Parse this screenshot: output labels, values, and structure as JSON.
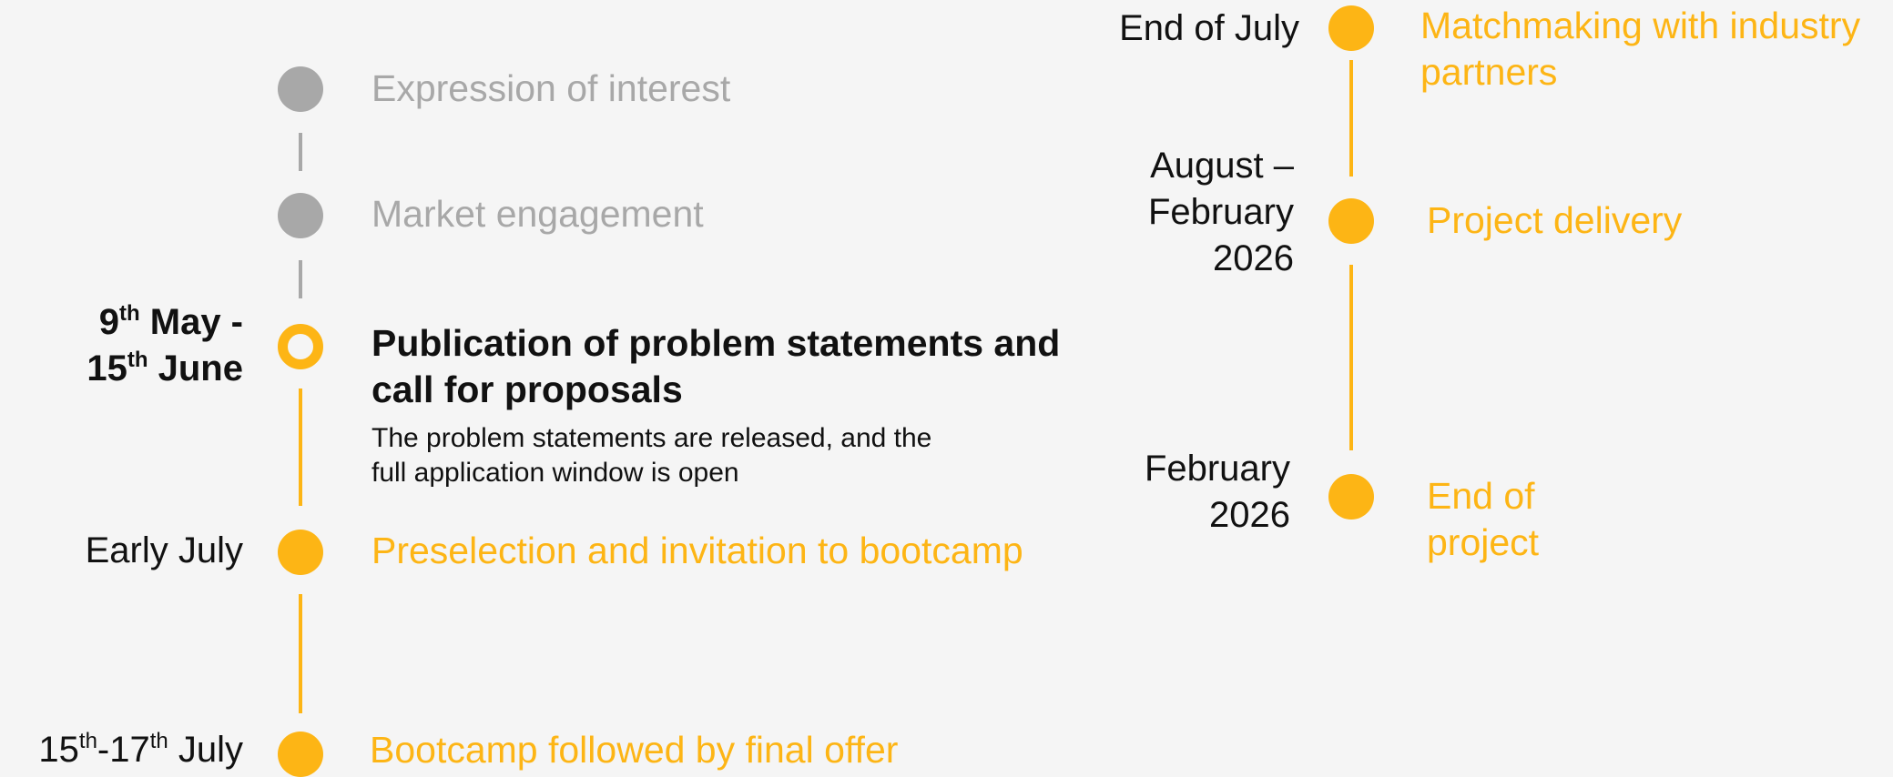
{
  "colors": {
    "accent": "#fdb515",
    "muted": "#a8a8a8",
    "text": "#111111",
    "background": "#f5f5f5"
  },
  "left": {
    "expression": {
      "label": "Expression of interest"
    },
    "market": {
      "label": "Market engagement"
    },
    "publication": {
      "date_1_num": "9",
      "date_1_sup": "th",
      "date_1_rest": " May -",
      "date_2_num": "15",
      "date_2_sup": "th",
      "date_2_rest": " June",
      "label_line1": "Publication of problem statements and",
      "label_line2": "call for proposals",
      "desc_line1": "The problem statements are released, and the",
      "desc_line2": "full application window is open"
    },
    "preselection": {
      "date": "Early July",
      "label": "Preselection and invitation to bootcamp"
    },
    "bootcamp": {
      "date_a_num": "15",
      "date_a_sup": "th",
      "date_b_num": "-17",
      "date_b_sup": "th",
      "date_rest": " July",
      "label": "Bootcamp followed by final offer"
    }
  },
  "right": {
    "matchmaking": {
      "date": "End of July",
      "label_line1": "Matchmaking with industry",
      "label_line2": "partners"
    },
    "delivery": {
      "date_line1": "August –",
      "date_line2": "February",
      "date_line3": "2026",
      "label": "Project delivery"
    },
    "end": {
      "date_line1": "February",
      "date_line2": "2026",
      "label_line1": "End of",
      "label_line2": "project"
    }
  }
}
